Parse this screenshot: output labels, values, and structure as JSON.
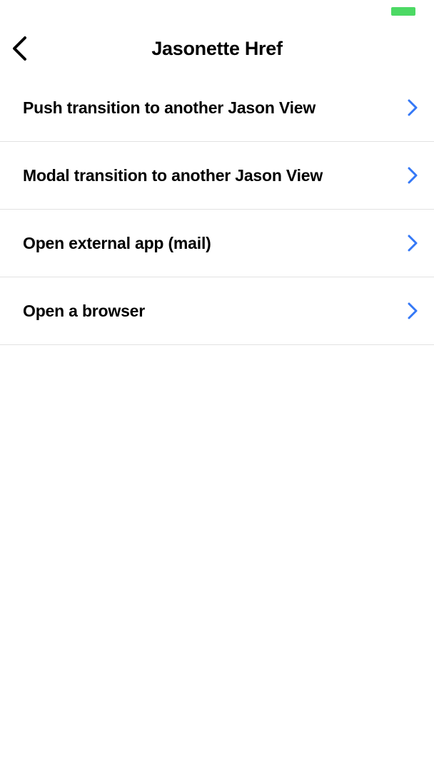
{
  "status_bar": {
    "battery_color": "#4cd964"
  },
  "nav": {
    "title": "Jasonette Href",
    "back_icon": "chevron-left-icon"
  },
  "list": {
    "chevron_icon": "chevron-right-icon",
    "chevron_color": "#3478f6",
    "items": [
      {
        "label": "Push transition to another Jason View"
      },
      {
        "label": "Modal transition to another Jason View"
      },
      {
        "label": "Open external app (mail)"
      },
      {
        "label": "Open a browser"
      }
    ]
  }
}
